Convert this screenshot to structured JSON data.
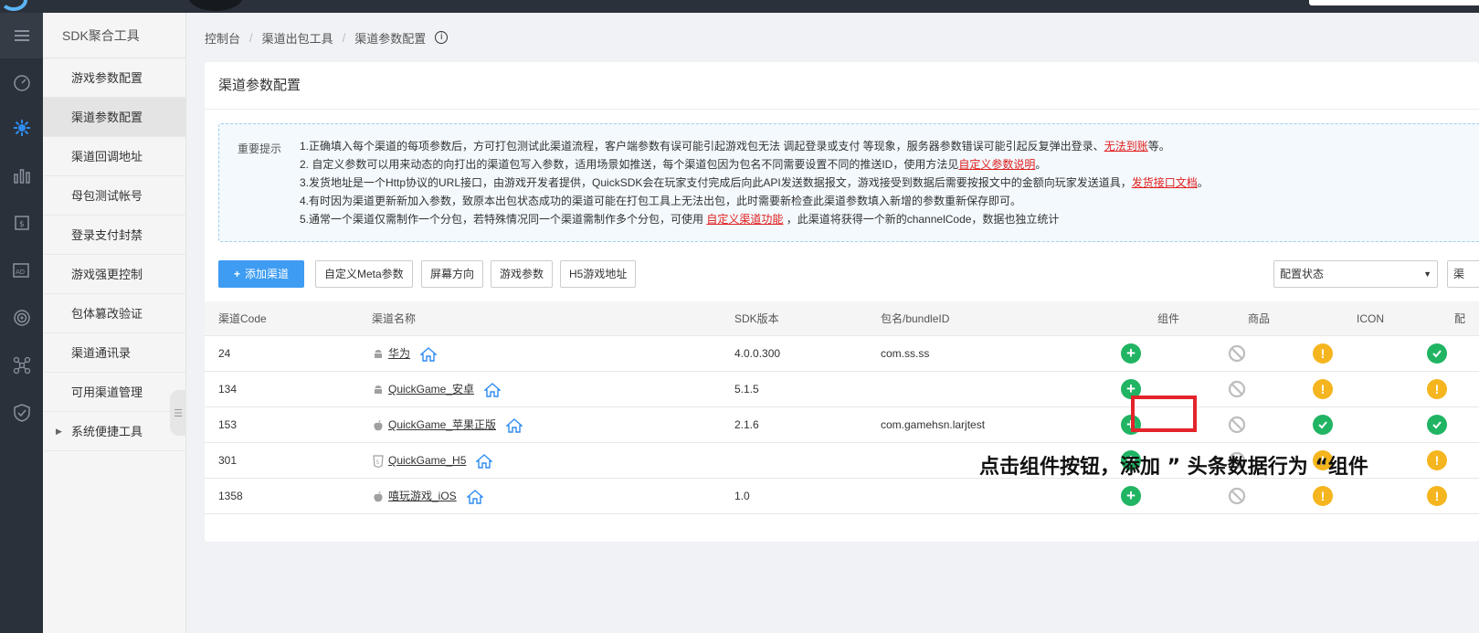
{
  "submenu": {
    "title": "SDK聚合工具",
    "items": [
      {
        "label": "游戏参数配置"
      },
      {
        "label": "渠道参数配置"
      },
      {
        "label": "渠道回调地址"
      },
      {
        "label": "母包测试帐号"
      },
      {
        "label": "登录支付封禁"
      },
      {
        "label": "游戏强更控制"
      },
      {
        "label": "包体篡改验证"
      },
      {
        "label": "渠道通讯录"
      },
      {
        "label": "可用渠道管理"
      },
      {
        "label": "系统便捷工具"
      }
    ]
  },
  "breadcrumb": {
    "items": [
      "控制台",
      "渠道出包工具",
      "渠道参数配置"
    ],
    "info_icon": "i"
  },
  "card": {
    "title": "渠道参数配置"
  },
  "notice": {
    "label": "重要提示",
    "line1_a": "1.正确填入每个渠道的每项参数后，方可打包测试此渠道流程，客户端参数有误可能引起游戏包无法 调起登录或支付 等现象，服务器参数错误可能引起反复弹出登录、",
    "line1_link": "无法到账",
    "line1_b": "等。",
    "line2_a": "2. 自定义参数可以用来动态的向打出的渠道包写入参数，适用场景如推送，每个渠道包因为包名不同需要设置不同的推送ID，使用方法见",
    "line2_link": "自定义参数说明",
    "line2_b": "。",
    "line3_a": "3.发货地址是一个Http协议的URL接口，由游戏开发者提供，QuickSDK会在玩家支付完成后向此API发送数据报文，游戏接受到数据后需要按报文中的金额向玩家发送道具，",
    "line3_link": "发货接口文档",
    "line3_b": "。",
    "line4": "4.有时因为渠道更新新加入参数，致原本出包状态成功的渠道可能在打包工具上无法出包，此时需要新检查此渠道参数填入新增的参数重新保存即可。",
    "line5_a": "5.通常一个渠道仅需制作一个分包，若特殊情况同一个渠道需制作多个分包，可使用 ",
    "line5_link": "自定义渠道功能",
    "line5_b": " ，此渠道将获得一个新的channelCode，数据也独立统计"
  },
  "toolbar": {
    "add_label": "添加渠道",
    "meta_label": "自定义Meta参数",
    "orientation_label": "屏幕方向",
    "game_params_label": "游戏参数",
    "h5_label": "H5游戏地址",
    "status_select": "配置状态",
    "extra_select": "渠"
  },
  "table": {
    "headers": [
      "渠道Code",
      "渠道名称",
      "SDK版本",
      "包名/bundleID",
      "组件",
      "商品",
      "ICON",
      "配"
    ],
    "rows": [
      {
        "code": "24",
        "name": "华为",
        "os": "android-icon",
        "sdk": "4.0.0.300",
        "bundle": "com.ss.ss",
        "icon_status": "warning",
        "config_status": "ok"
      },
      {
        "code": "134",
        "name": "QuickGame_安卓",
        "os": "android-icon",
        "sdk": "5.1.5",
        "bundle": "",
        "icon_status": "warning",
        "config_status": "warning"
      },
      {
        "code": "153",
        "name": "QuickGame_苹果正版",
        "os": "apple-icon",
        "sdk": "2.1.6",
        "bundle": "com.gamehsn.larjtest",
        "icon_status": "ok",
        "config_status": "ok"
      },
      {
        "code": "301",
        "name": "QuickGame_H5",
        "os": "html5-icon",
        "sdk": "",
        "bundle": "",
        "icon_status": "warning",
        "config_status": "warning"
      },
      {
        "code": "1358",
        "name": "嘻玩游戏_iOS",
        "os": "apple-icon",
        "sdk": "1.0",
        "bundle": "",
        "icon_status": "warning",
        "config_status": "warning"
      }
    ]
  },
  "annotation": {
    "text": "点击组件按钮，添加 ” 头条数据行为 “组件"
  },
  "colors": {
    "primary": "#3e9cf2",
    "green": "#20b463",
    "yellow": "#f5b51e",
    "red_link": "#e02020",
    "highlight": "#e3242b"
  }
}
